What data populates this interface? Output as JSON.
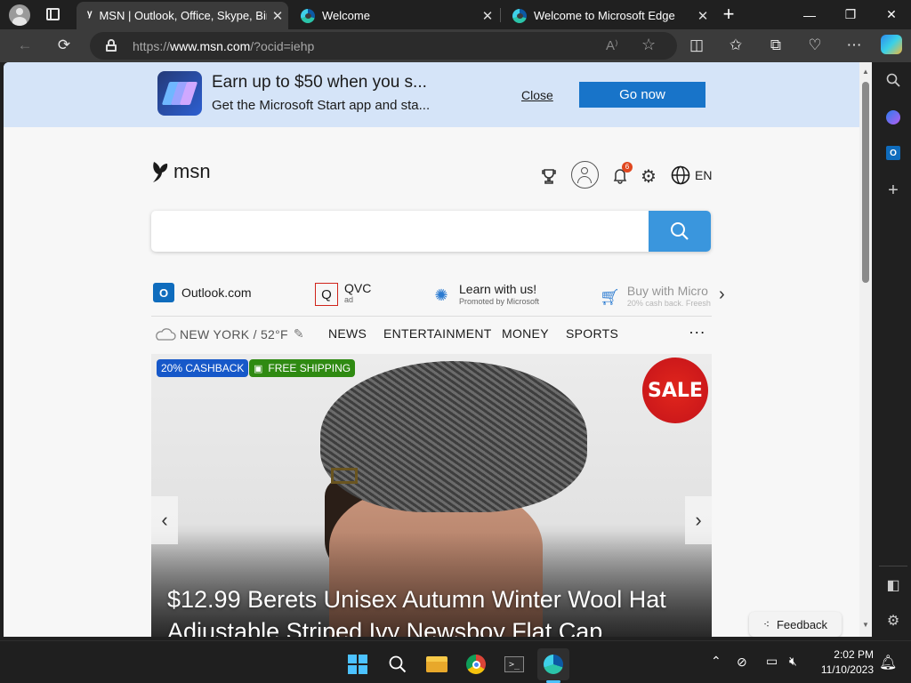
{
  "browser": {
    "tabs": [
      {
        "title": "MSN | Outlook, Office, Skype, Bing"
      },
      {
        "title": "Welcome"
      },
      {
        "title": "Welcome to Microsoft Edge"
      }
    ],
    "new_tab": "+",
    "url_prefix": "https://",
    "url_host": "www.msn.com",
    "url_path": "/?ocid=iehp"
  },
  "banner": {
    "title": "Earn up to $50 when you s...",
    "subtitle": "Get the Microsoft Start app and sta...",
    "close_label": "Close",
    "go_label": "Go now"
  },
  "header": {
    "logo_text": "msn",
    "notification_count": "6",
    "language": "EN"
  },
  "quicklinks": [
    {
      "label": "Outlook.com",
      "sub": ""
    },
    {
      "label": "QVC",
      "sub": "ad"
    },
    {
      "label": "Learn with us!",
      "sub": "Promoted by Microsoft"
    },
    {
      "label": "Buy with Micro",
      "sub": "20% cash back. Freesh"
    }
  ],
  "nav": {
    "weather": "NEW YORK / 52°F",
    "items": [
      "NEWS",
      "ENTERTAINMENT",
      "MONEY",
      "SPORTS"
    ],
    "more": "···"
  },
  "hero": {
    "badge_cashback": "20% CASHBACK",
    "badge_shipping": "FREE SHIPPING",
    "sale": "SALE",
    "title": "$12.99 Berets Unisex Autumn Winter Wool Hat Adjustable Striped Ivy Newsboy Flat Cap"
  },
  "feedback_label": "Feedback",
  "taskbar": {
    "time": "2:02 PM",
    "date": "11/10/2023"
  }
}
